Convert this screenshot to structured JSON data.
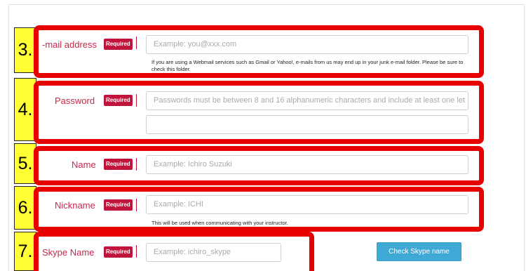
{
  "required_badge": "Required",
  "steps": [
    "3.",
    "4.",
    "5.",
    "6.",
    "7."
  ],
  "email": {
    "label": "-mail address",
    "placeholder": "Example: you@xxx.com",
    "help": "If you are using a Webmail services such as Gmail or Yahoo!, e-mails from us may end up in your junk e-mail folder. Please be sure to check this folder."
  },
  "password": {
    "label": "Password",
    "placeholder": "Passwords must be between 8 and 16 alphanumeric characters and include at least one let",
    "confirm_placeholder": ""
  },
  "name": {
    "label": "Name",
    "placeholder": "Example: Ichiro Suzuki"
  },
  "nickname": {
    "label": "Nickname",
    "placeholder": "Example: ICHI",
    "help": "This will be used when communicating with your instructor."
  },
  "skype": {
    "label": "Skype Name",
    "placeholder": "Example: ichiro_skype",
    "button": "Check Skype name"
  },
  "colors": {
    "highlight_border": "#e80000",
    "step_box": "#ffff33",
    "label": "#c9284d",
    "badge": "#c0143c",
    "button": "#3fa9d6"
  }
}
